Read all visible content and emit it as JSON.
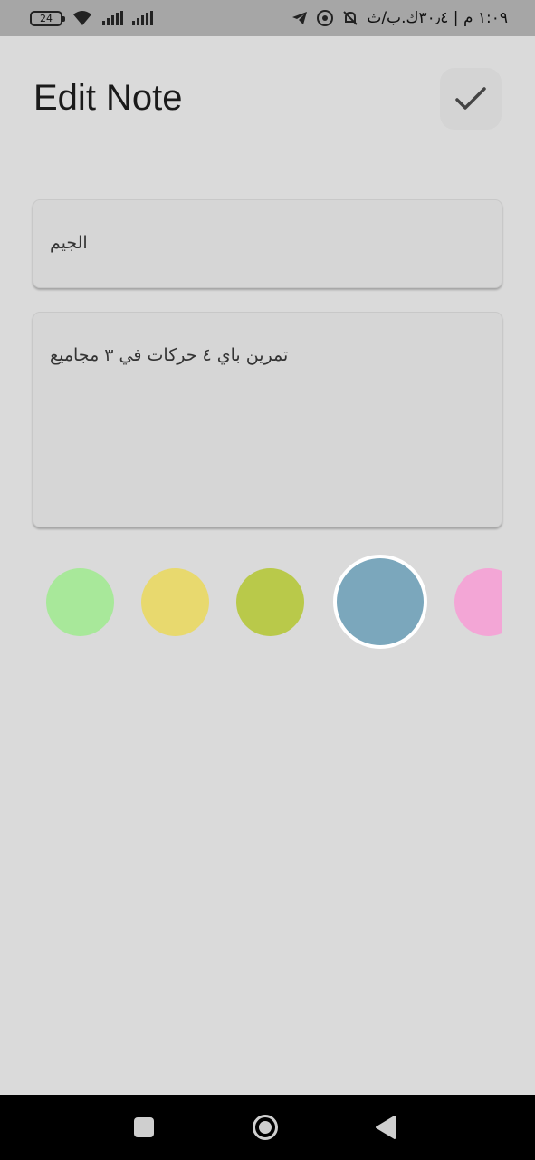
{
  "status_bar": {
    "battery": "24",
    "right_text": "١:٠٩ م | ٣٠٫٤ك.ب/ث"
  },
  "header": {
    "title": "Edit Note",
    "save_icon": "check-icon"
  },
  "note": {
    "title_value": "الجيم",
    "content_value": "تمرين باي  ٤ حركات في ٣ مجاميع"
  },
  "colors": {
    "options": [
      "#a8e89a",
      "#e8d96e",
      "#b9c94a",
      "#7ba7bc",
      "#f3a6d6"
    ],
    "selected": "#7ba7bc"
  },
  "nav": {
    "recents_icon": "square-icon",
    "home_icon": "circle-icon",
    "back_icon": "triangle-back-icon"
  }
}
